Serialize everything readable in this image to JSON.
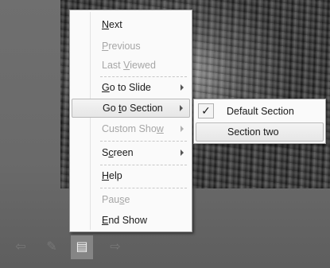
{
  "menu": {
    "items": [
      {
        "label": "Next",
        "mnemonic": "N",
        "disabled": false,
        "has_submenu": false
      },
      {
        "label": "Previous",
        "mnemonic": "P",
        "disabled": true,
        "has_submenu": false
      },
      {
        "label": "Last Viewed",
        "mnemonic": "V",
        "disabled": true,
        "has_submenu": false
      },
      {
        "label": "Go to Slide",
        "mnemonic": "G",
        "disabled": false,
        "has_submenu": true
      },
      {
        "label": "Go to Section",
        "mnemonic": "t",
        "disabled": false,
        "has_submenu": true,
        "highlighted": true
      },
      {
        "label": "Custom Show",
        "mnemonic": "w",
        "disabled": true,
        "has_submenu": true
      },
      {
        "label": "Screen",
        "mnemonic": "c",
        "disabled": false,
        "has_submenu": true
      },
      {
        "label": "Help",
        "mnemonic": "H",
        "disabled": false,
        "has_submenu": false
      },
      {
        "label": "Pause",
        "mnemonic": "s",
        "disabled": true,
        "has_submenu": false
      },
      {
        "label": "End Show",
        "mnemonic": "E",
        "disabled": false,
        "has_submenu": false
      }
    ]
  },
  "submenu": {
    "items": [
      {
        "label": "Default Section",
        "checked": true,
        "check_glyph": "✓"
      },
      {
        "label": "Section two",
        "checked": false,
        "highlighted": true
      }
    ]
  },
  "toolbar": {
    "buttons": [
      {
        "icon": "previous-arrow-icon",
        "glyph": "⇦"
      },
      {
        "icon": "pen-icon",
        "glyph": "✎"
      },
      {
        "icon": "slide-menu-icon",
        "glyph": "▤",
        "active": true
      },
      {
        "icon": "next-arrow-icon",
        "glyph": "⇨"
      }
    ]
  },
  "colors": {
    "menu_background": "#fafafa",
    "highlight": "#e6e6e6",
    "disabled_text": "#a6a6a6",
    "backdrop": "#6b6b6b"
  }
}
